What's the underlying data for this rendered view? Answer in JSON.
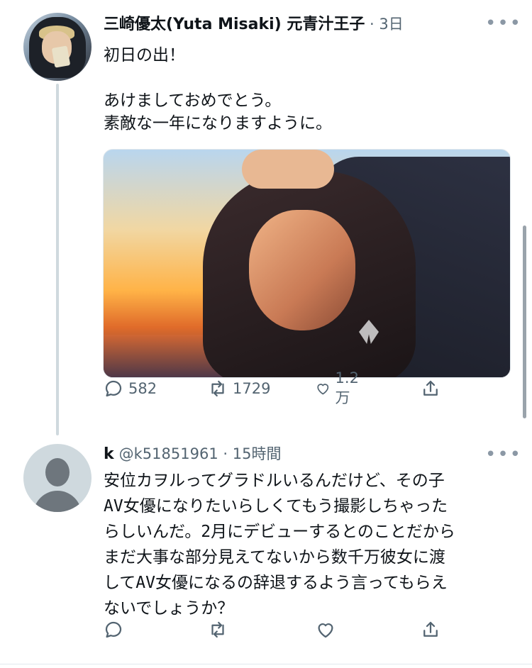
{
  "tweet1": {
    "display_name": "三崎優太(Yuta Misaki) 元青汁王子",
    "separator": " · ",
    "time": "3日",
    "text": "初日の出！\n\nあけましておめでとう。\n素敵な一年になりますように。",
    "reply_count": "582",
    "retweet_count": "1729",
    "like_count": "1.2万"
  },
  "tweet2": {
    "display_name": "k",
    "handle": "@k51851961",
    "separator": " · ",
    "time": "15時間",
    "text": "安位カヲルってグラドルいるんだけど、その子\nAV女優になりたいらしくてもう撮影しちゃった\nらしいんだ。2月にデビューするとのことだから\nまだ大事な部分見えてないから数千万彼女に渡\nしてAV女優になるの辞退するよう言ってもらえ\nないでしょうか？"
  },
  "icons": [
    "reply-icon",
    "retweet-icon",
    "like-icon",
    "share-icon",
    "more-icon"
  ],
  "colors": {
    "text": "#0f1419",
    "secondary": "#536471",
    "thread_line": "#cfd9de"
  }
}
